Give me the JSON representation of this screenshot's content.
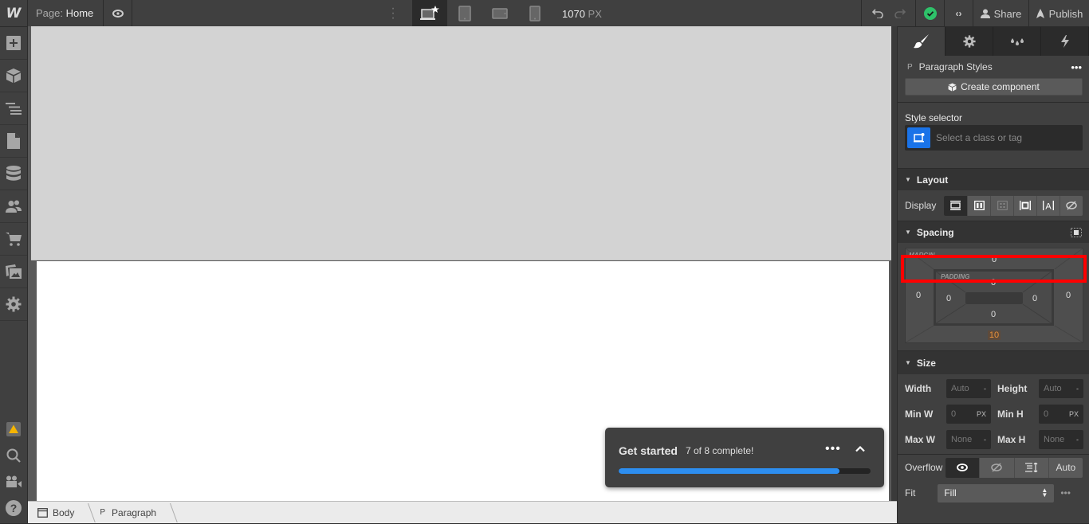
{
  "topbar": {
    "logo": "W",
    "page_prefix": "Page:",
    "page_name": "Home",
    "viewport_width": "1070",
    "viewport_unit": "PX",
    "share_label": "Share",
    "publish_label": "Publish",
    "devices": [
      "desktop-base",
      "tablet",
      "mobile-landscape",
      "mobile-portrait"
    ]
  },
  "left_toolbar": {
    "items": [
      "add-panel",
      "components",
      "navigator",
      "pages",
      "cms",
      "users",
      "ecommerce",
      "assets",
      "settings"
    ],
    "bottom_items": [
      "audit-warning",
      "search",
      "video-tutorials",
      "help"
    ]
  },
  "get_started": {
    "title": "Get started",
    "status": "7 of 8 complete!",
    "completed": 7,
    "total": 8,
    "progress_percent": 87.5,
    "accent": "#2d8ef0"
  },
  "breadcrumb": [
    {
      "icon": "body-icon",
      "label": "Body"
    },
    {
      "icon": "P",
      "label": "Paragraph"
    }
  ],
  "panel": {
    "tabs": [
      "style",
      "settings",
      "interactions-color",
      "interactions"
    ],
    "element_tag": "P",
    "element_title": "Paragraph Styles",
    "create_component_label": "Create component",
    "style_selector_label": "Style selector",
    "style_selector_placeholder": "Select a class or tag",
    "layout": {
      "title": "Layout",
      "display_label": "Display",
      "display_options": [
        "block",
        "flex",
        "grid",
        "inline-block",
        "inline",
        "none"
      ],
      "display_active": "block"
    },
    "spacing": {
      "title": "Spacing",
      "margin_label": "MARGIN",
      "padding_label": "PADDING",
      "margin": {
        "top": "0",
        "right": "0",
        "bottom": "10",
        "left": "0"
      },
      "padding": {
        "top": "0",
        "right": "0",
        "bottom": "0",
        "left": "0"
      },
      "bottom_highlight_color": "#e8913a"
    },
    "size": {
      "title": "Size",
      "width_label": "Width",
      "width_value": "Auto",
      "width_unit": "-",
      "height_label": "Height",
      "height_value": "Auto",
      "height_unit": "-",
      "min_w_label": "Min W",
      "min_w_value": "0",
      "min_w_unit": "PX",
      "min_h_label": "Min H",
      "min_h_value": "0",
      "min_h_unit": "PX",
      "max_w_label": "Max W",
      "max_w_value": "None",
      "max_w_unit": "-",
      "max_h_label": "Max H",
      "max_h_value": "None",
      "max_h_unit": "-",
      "overflow_label": "Overflow",
      "overflow_options": [
        "visible",
        "hidden",
        "scroll",
        "Auto"
      ],
      "overflow_active": "visible",
      "fit_label": "Fit",
      "fit_value": "Fill"
    }
  }
}
